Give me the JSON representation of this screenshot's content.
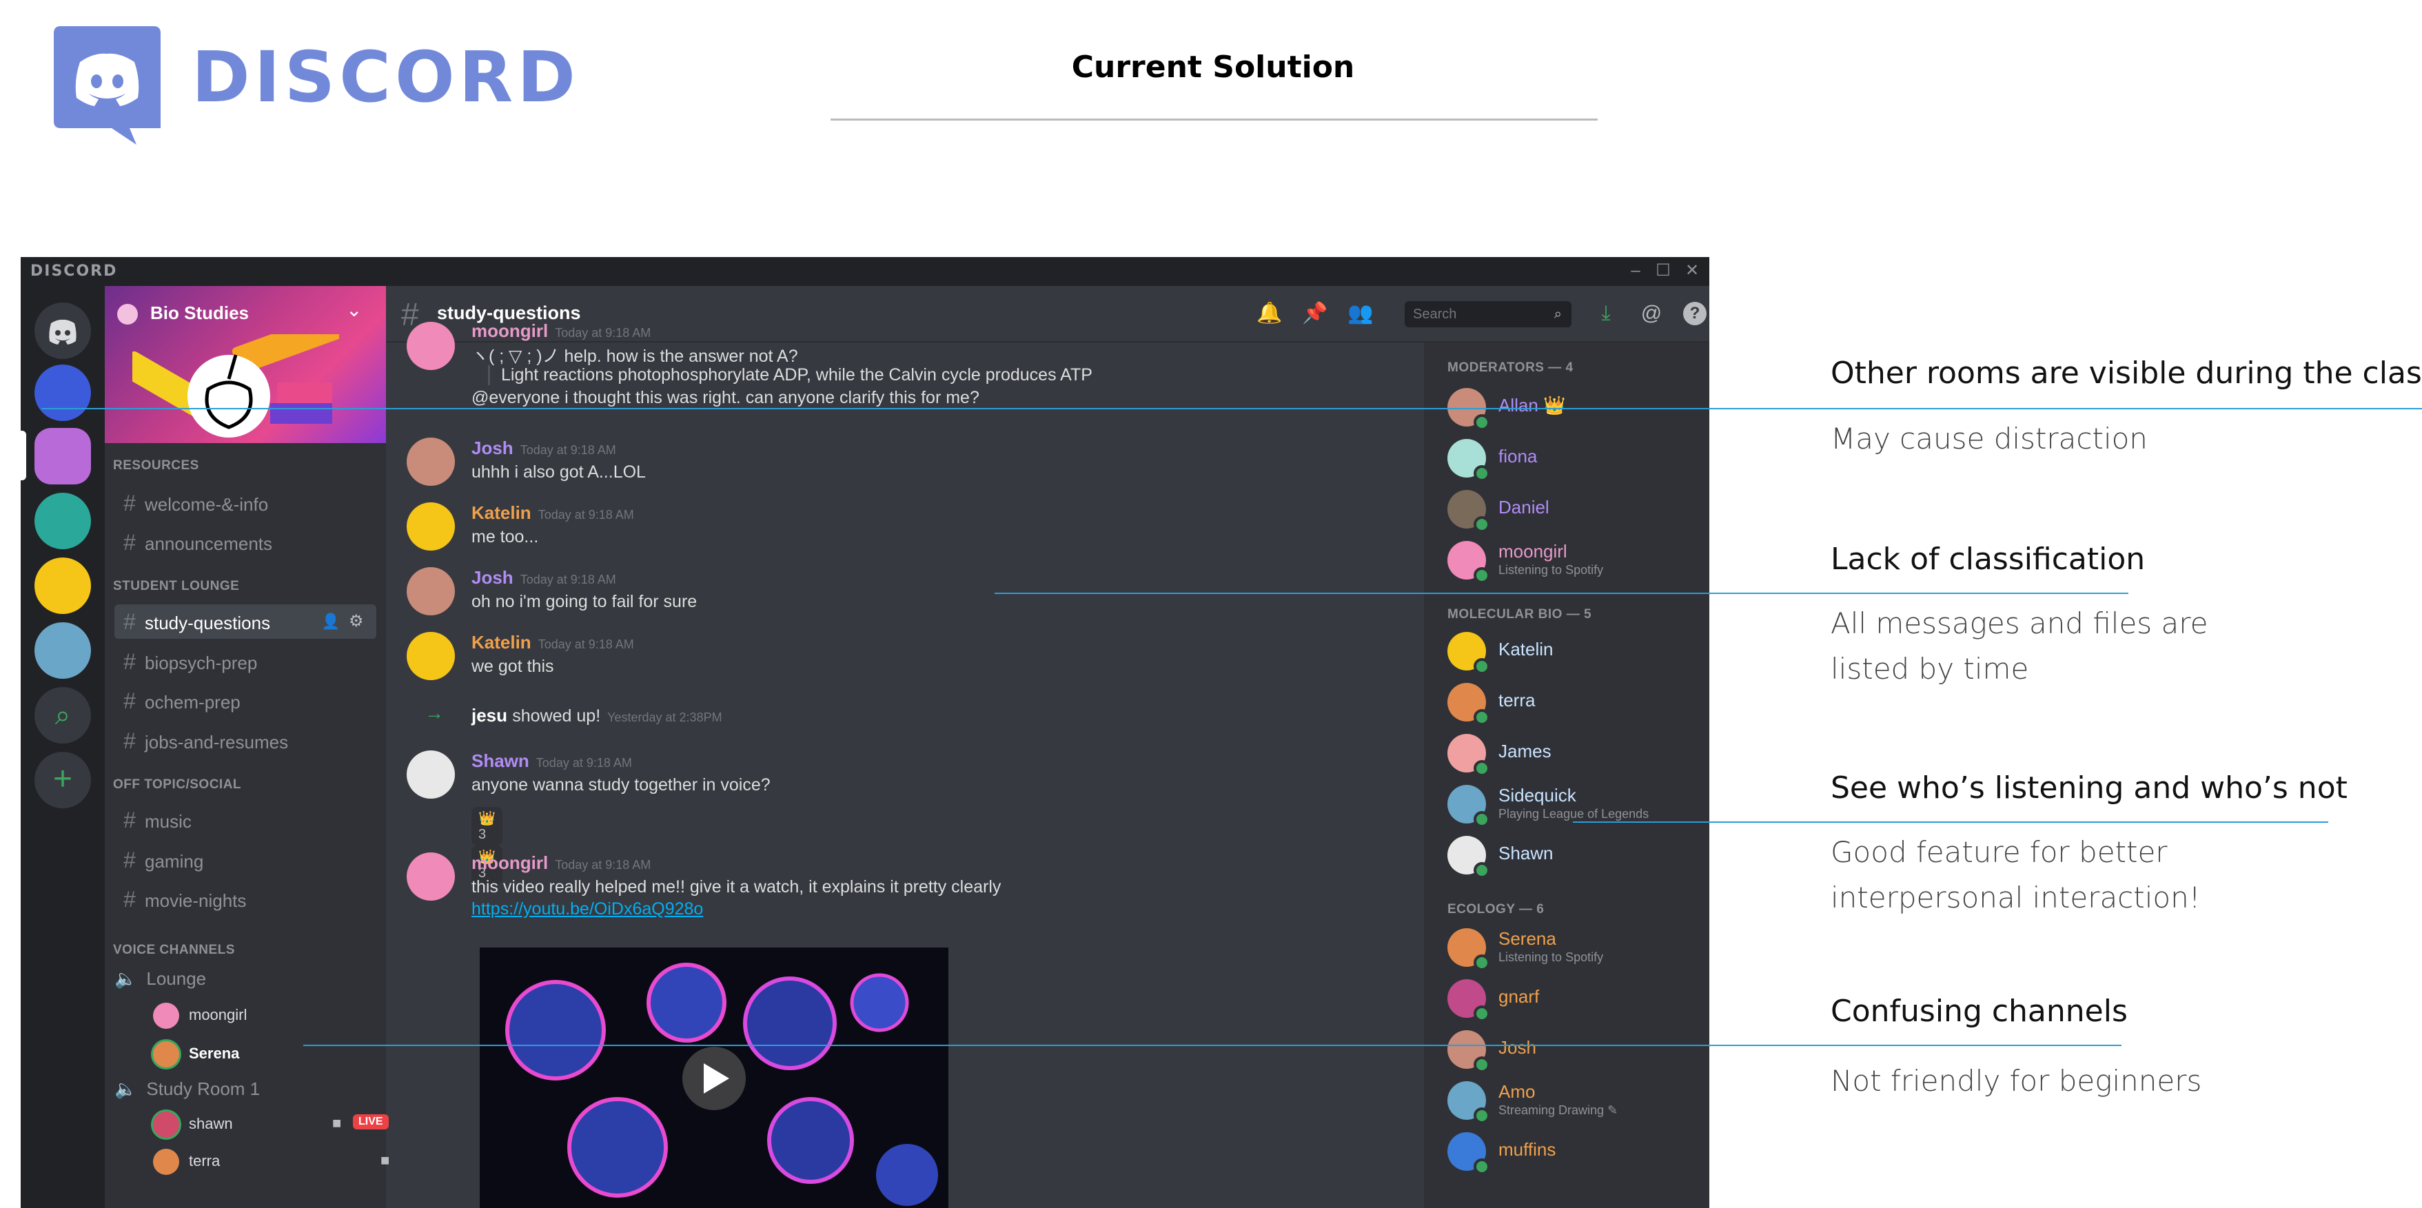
{
  "brand": {
    "wordmark": "DISCORD"
  },
  "slide": {
    "title": "Current Solution"
  },
  "app": {
    "window_logo": "DISCORD",
    "window_controls": {
      "minimize": "–",
      "maximize": "☐",
      "close": "✕"
    },
    "guild": {
      "name": "Bio Studies",
      "chevron": "⌄"
    },
    "categories": {
      "resources": "RESOURCES",
      "student_lounge": "STUDENT LOUNGE",
      "off_topic": "OFF TOPIC/SOCIAL",
      "voice": "VOICE CHANNELS"
    },
    "channels": [
      {
        "name": "welcome-&-info"
      },
      {
        "name": "announcements"
      },
      {
        "name": "study-questions"
      },
      {
        "name": "biopsych-prep"
      },
      {
        "name": "ochem-prep"
      },
      {
        "name": "jobs-and-resumes"
      },
      {
        "name": "music"
      },
      {
        "name": "gaming"
      },
      {
        "name": "movie-nights"
      }
    ],
    "hash": "#",
    "voice": {
      "lounge": "Lounge",
      "lounge_users": [
        "moongirl",
        "Serena"
      ],
      "study_room": "Study Room 1",
      "study_users": [
        "shawn",
        "terra"
      ],
      "live_badge": "LIVE"
    },
    "chat": {
      "channel_name": "study-questions",
      "search_placeholder": "Search",
      "messages": [
        {
          "author": "moongirl",
          "time": "Today at 9:18 AM",
          "lines": [
            "ヽ( ; ▽ ; )ノ help. how is the answer not A?",
            "Light reactions photophosphorylate ADP, while the Calvin cycle produces ATP",
            "@everyone i thought this was right. can anyone clarify this for me?"
          ],
          "color": "#e79ac9"
        },
        {
          "author": "Josh",
          "time": "Today at 9:18 AM",
          "lines": [
            "uhhh i also got A...LOL"
          ],
          "color": "#b18cf5"
        },
        {
          "author": "Katelin",
          "time": "Today at 9:18 AM",
          "lines": [
            "me too..."
          ],
          "color": "#f0a04b"
        },
        {
          "author": "Josh",
          "time": "Today at 9:18 AM",
          "lines": [
            "oh no i'm going to fail for sure"
          ],
          "color": "#b18cf5"
        },
        {
          "author": "Katelin",
          "time": "Today at 9:18 AM",
          "lines": [
            "we got this"
          ],
          "color": "#f0a04b"
        },
        {
          "author": "jesu",
          "time": "Yesterday at 2:38PM",
          "lines": [
            "showed up!"
          ],
          "color": "#ffffff"
        },
        {
          "author": "Shawn",
          "time": "Today at 9:18 AM",
          "lines": [
            "anyone wanna study together in voice?"
          ],
          "color": "#b18cf5"
        },
        {
          "author": "moongirl",
          "time": "Today at 9:18 AM",
          "lines": [
            "this video really helped me!! give it a watch, it explains it pretty clearly",
            "https://youtu.be/OiDx6aQ928o"
          ],
          "color": "#e79ac9"
        }
      ],
      "reactions": [
        "👑 3",
        "👑 3"
      ]
    },
    "members": {
      "moderators_header": "MODERATORS — 4",
      "molecular_header": "MOLECULAR BIO — 5",
      "ecology_header": "ECOLOGY — 6",
      "moderators": [
        {
          "name": "Allan 👑",
          "activity": "",
          "color": "#b18cf5"
        },
        {
          "name": "fiona",
          "activity": "",
          "color": "#b18cf5"
        },
        {
          "name": "Daniel",
          "activity": "",
          "color": "#b18cf5"
        },
        {
          "name": "moongirl",
          "activity": "Listening to Spotify",
          "color": "#e79ac9"
        }
      ],
      "molecular": [
        {
          "name": "Katelin",
          "activity": "",
          "color": "#c9e3ff"
        },
        {
          "name": "terra",
          "activity": "",
          "color": "#c9e3ff"
        },
        {
          "name": "James",
          "activity": "",
          "color": "#c9e3ff"
        },
        {
          "name": "Sidequick",
          "activity": "Playing League of Legends",
          "color": "#c9e3ff"
        },
        {
          "name": "Shawn",
          "activity": "",
          "color": "#c9e3ff"
        }
      ],
      "ecology": [
        {
          "name": "Serena",
          "activity": "Listening to Spotify",
          "color": "#f0a04b"
        },
        {
          "name": "gnarf",
          "activity": "",
          "color": "#f0a04b"
        },
        {
          "name": "Josh",
          "activity": "",
          "color": "#f0a04b"
        },
        {
          "name": "Amo",
          "activity": "Streaming Drawing ✎",
          "color": "#f0a04b"
        },
        {
          "name": "muffins",
          "activity": "",
          "color": "#f0a04b"
        }
      ]
    }
  },
  "annotations": [
    {
      "heading": "Other rooms are visible during the class",
      "sub": "May cause distraction"
    },
    {
      "heading": "Lack of classification",
      "sub": "All messages and files are listed by time"
    },
    {
      "heading": "See who’s listening and who’s not",
      "sub": "Good feature for better interpersonal interaction!"
    },
    {
      "heading": "Confusing channels",
      "sub": "Not friendly for beginners"
    }
  ],
  "colors": {
    "accent": "#7289da",
    "annotation_line": "#2a9fd6",
    "online": "#3ba55d",
    "link": "#00aff4",
    "mention": "#8ea1e1"
  }
}
